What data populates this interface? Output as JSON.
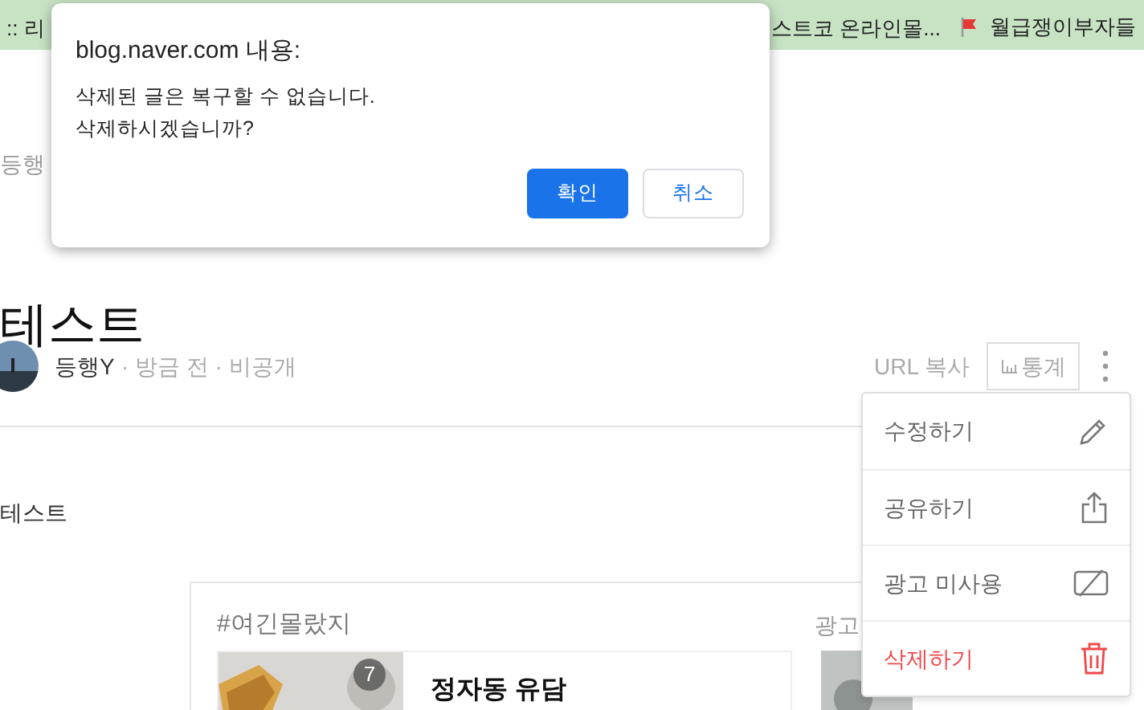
{
  "bookmarks": [
    {
      "label": ":: 리",
      "kind": "text"
    },
    {
      "label": "스트코 온라인몰...",
      "kind": "text"
    },
    {
      "label": "월급쟁이부자들",
      "kind": "flag"
    }
  ],
  "dialog": {
    "title": "blog.naver.com 내용:",
    "message": [
      "삭제된 글은 복구할 수 없습니다.",
      "삭제하시겠습니까?"
    ],
    "buttons": [
      {
        "label": "확인",
        "kind": "primary"
      },
      {
        "label": "취소",
        "kind": "secondary"
      }
    ]
  },
  "post": {
    "category": "등행",
    "title": "테스트",
    "author": "등행Y",
    "time": "· 방금 전",
    "visibility": "· 비공개",
    "url_copy": "URL 복사",
    "stats": "통계",
    "body": "테스트"
  },
  "menu": [
    {
      "label": "수정하기",
      "kind": "edit"
    },
    {
      "label": "공유하기",
      "kind": "share"
    },
    {
      "label": "광고 미사용",
      "kind": "ad"
    },
    {
      "label": "삭제하기",
      "kind": "delete"
    }
  ],
  "card": {
    "tag": "#여긴몰랐지",
    "ad": "광고",
    "item": {
      "badge": "7",
      "title": "정자동 유담"
    }
  }
}
